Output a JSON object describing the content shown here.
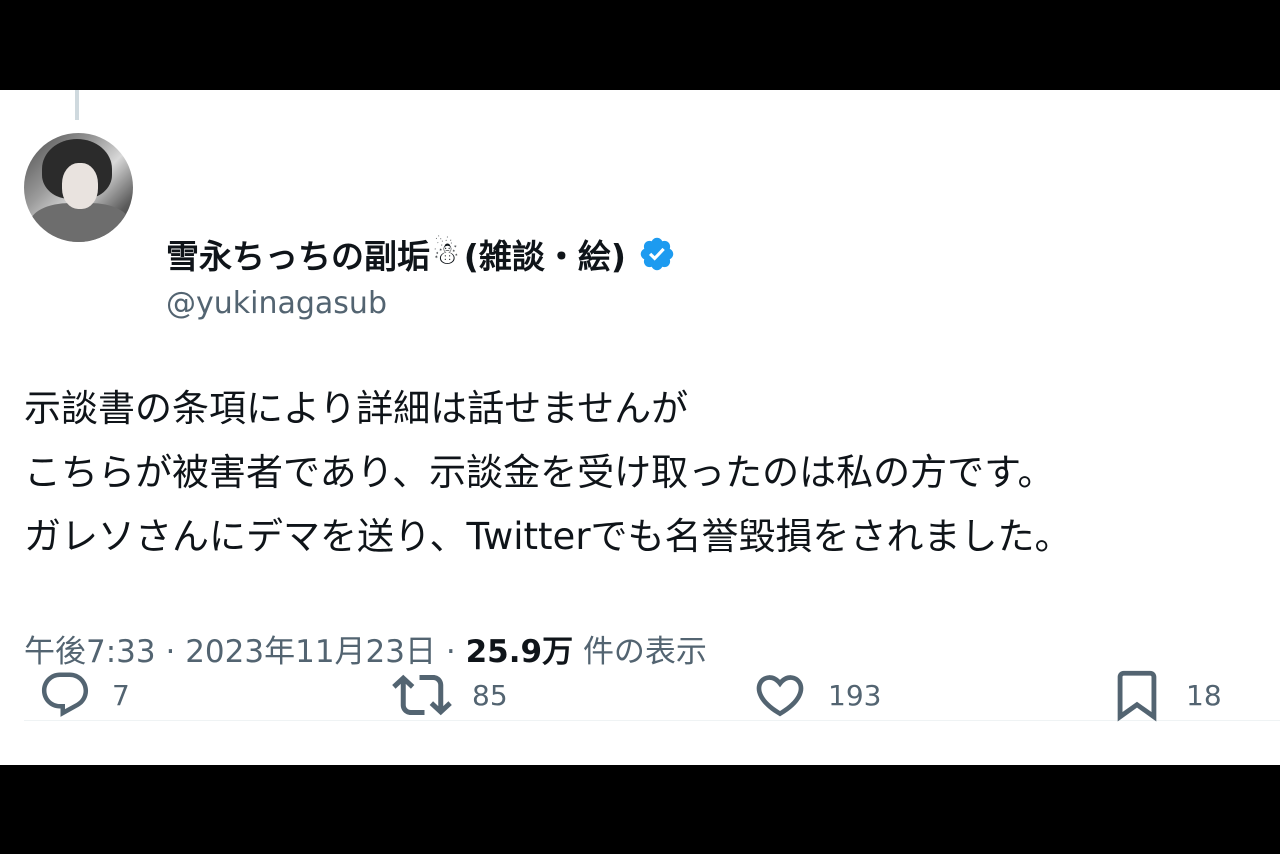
{
  "tweet": {
    "display_name": "雪永ちっちの副垢",
    "name_emoji": "☃",
    "name_suffix": "(雑談・絵)",
    "handle": "@yukinagasub",
    "text_lines": [
      "示談書の条項により詳細は話せませんが",
      "こちらが被害者であり、示談金を受け取ったのは私の方です。",
      "ガレソさんにデマを送り、Twitterでも名誉毀損をされました。"
    ],
    "time": "午後7:33",
    "date": "2023年11月23日",
    "separator": "·",
    "views_count": "25.9万",
    "views_label": "件の表示"
  },
  "actions": {
    "reply": {
      "icon": "reply-icon",
      "count": "7"
    },
    "retweet": {
      "icon": "retweet-icon",
      "count": "85"
    },
    "like": {
      "icon": "heart-icon",
      "count": "193"
    },
    "bookmark": {
      "icon": "bookmark-icon",
      "count": "18"
    }
  },
  "colors": {
    "text_primary": "#0f1419",
    "text_secondary": "#536471",
    "verified": "#1d9bf0",
    "divider": "#eff3f4",
    "letterbox": "#000000"
  }
}
